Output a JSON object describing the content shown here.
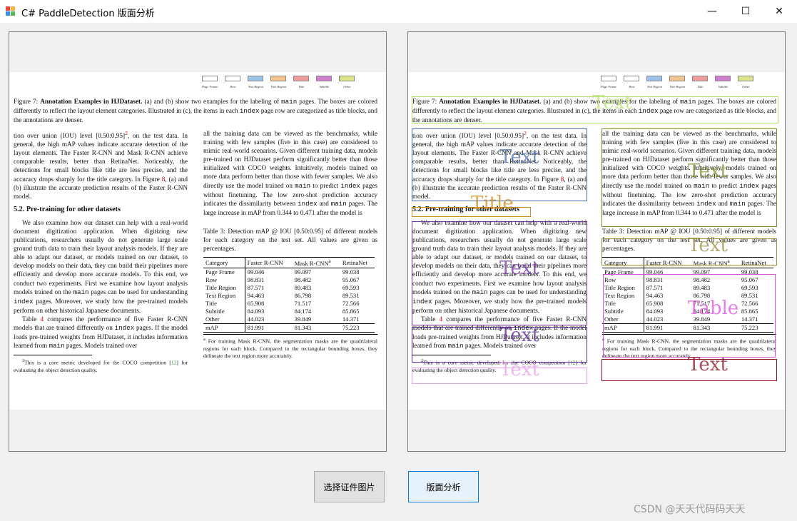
{
  "window": {
    "title": "C# PaddleDetection 版面分析",
    "controls": {
      "minimize": "—",
      "maximize": "☐",
      "close": "✕"
    }
  },
  "document": {
    "legend": [
      "Page Frame",
      "Row",
      "Text Region",
      "Title Region",
      "Title",
      "Subtitle",
      "Other"
    ],
    "legend_colors": [
      "#ffffff",
      "#ffffff",
      "#9cc3ea",
      "#f3c48f",
      "#ef9b9b",
      "#cf7fcf",
      "#dce58a"
    ],
    "caption": {
      "label": "Figure 7:",
      "bold": "Annotation Examples in HJDataset.",
      "t1": " (a) and (b) show two examples for the labeling of ",
      "m1": "main",
      "t2": " pages. The boxes are colored differently to reflect the layout element categories. Illustrated in (c), the items in each ",
      "m2": "index",
      "t3": " page row are categorized as title blocks, and the annotations are denser."
    },
    "col1": {
      "p1a": "tion over union (IOU) level [0.50:0.95]",
      "p1sup": "2",
      "p1b": ", on the test data. In general, the high mAP values indicate accurate detection of the layout elements. The Faster R-CNN and Mask R-CNN achieve comparable results, better than RetinaNet. Noticeably, the detections for small blocks like title are less precise, and the accuracy drops sharply for the title category. In Figure ",
      "p1ref": "8",
      "p1c": ", (a) and (b) illustrate the accurate prediction results of the Faster R-CNN model.",
      "heading": "5.2. Pre-training for other datasets",
      "p2a": "We also examine how our dataset can help with a real-world document digitization application. When digitizing new publications, researchers usually do not generate large scale ground truth data to train their layout analysis models. If they are able to adapt our dataset, or models trained on our dataset, to develop models on their data, they can build their pipelines more efficiently and develop more accurate models. To this end, we conduct two experiments. First we examine how layout analysis models trained on the ",
      "p2m1": "main",
      "p2b": " pages can be used for understanding ",
      "p2m2": "index",
      "p2c": " pages. Moreover, we study how the pre-trained models perform on other historical Japanese documents.",
      "p3a": "Table ",
      "p3ref": "4",
      "p3b": " compares the performance of five Faster R-CNN models that are trained differently on ",
      "p3m1": "index",
      "p3c": " pages. If the model loads pre-trained weights from HJDataset, it includes information learned from ",
      "p3m2": "main",
      "p3d": " pages. Models trained over",
      "fn_sup": "2",
      "fn_a": "This is a core metric developed for the COCO competition [",
      "fn_ref": "12",
      "fn_b": "] for evaluating the object detection quality."
    },
    "col2": {
      "p1a": "all the training data can be viewed as the benchmarks, while training with few samples (five in this case) are considered to mimic real-world scenarios. Given different training data, models pre-trained on HJDataset perform significantly better than those initialized with COCO weights. Intuitively, models trained on more data perform better than those with fewer samples. We also directly use the model trained on ",
      "p1m1": "main",
      "p1b": " to predict ",
      "p1m2": "index",
      "p1c": " pages without finetuning. The low zero-shot prediction accuracy indicates the dissimilarity between ",
      "p1m3": "index",
      "p1d": " and ",
      "p1m4": "main",
      "p1e": " pages. The large increase in mAP from 0.344 to 0.471 after the model is",
      "table_caption": "Table 3: Detection mAP @ IOU [0.50:0.95] of different models for each category on the test set. All values are given as percentages.",
      "table_headers": [
        "Category",
        "Faster R-CNN",
        "Mask R-CNN",
        "RetinaNet"
      ],
      "table_header_sup": "a",
      "table_rows": [
        [
          "Page Frame",
          "99.046",
          "99.097",
          "99.038"
        ],
        [
          "Row",
          "98.831",
          "98.482",
          "95.067"
        ],
        [
          "Title Region",
          "87.571",
          "89.483",
          "69.593"
        ],
        [
          "Text Region",
          "94.463",
          "86.798",
          "89.531"
        ],
        [
          "Title",
          "65.908",
          "71.517",
          "72.566"
        ],
        [
          "Subtitle",
          "84.093",
          "84.174",
          "85.865"
        ],
        [
          "Other",
          "44.023",
          "39.849",
          "14.371"
        ]
      ],
      "table_map": [
        "mAP",
        "81.991",
        "81.343",
        "75.223"
      ],
      "fn_sup": "a",
      "fn_text": "For training Mask R-CNN, the segmentation masks are the quadrilateral regions for each block. Compared to the rectangular bounding boxes, they delineate the text region more accurately."
    }
  },
  "overlays": {
    "labels": [
      "Text",
      "Text",
      "Title",
      "Text",
      "Text",
      "Text",
      "Text",
      "Text",
      "Table",
      "Text"
    ],
    "colors": [
      "#b5e06a",
      "#4b6fb0",
      "#d18b1a",
      "#7a8f2a",
      "#9a9040",
      "#7030a0",
      "#5b2a8f",
      "#e9a0e9",
      "#e050e0",
      "#8b1020"
    ]
  },
  "buttons": {
    "select_image": "选择证件图片",
    "analyze": "版面分析"
  },
  "watermark": "CSDN @天天代码码天天"
}
